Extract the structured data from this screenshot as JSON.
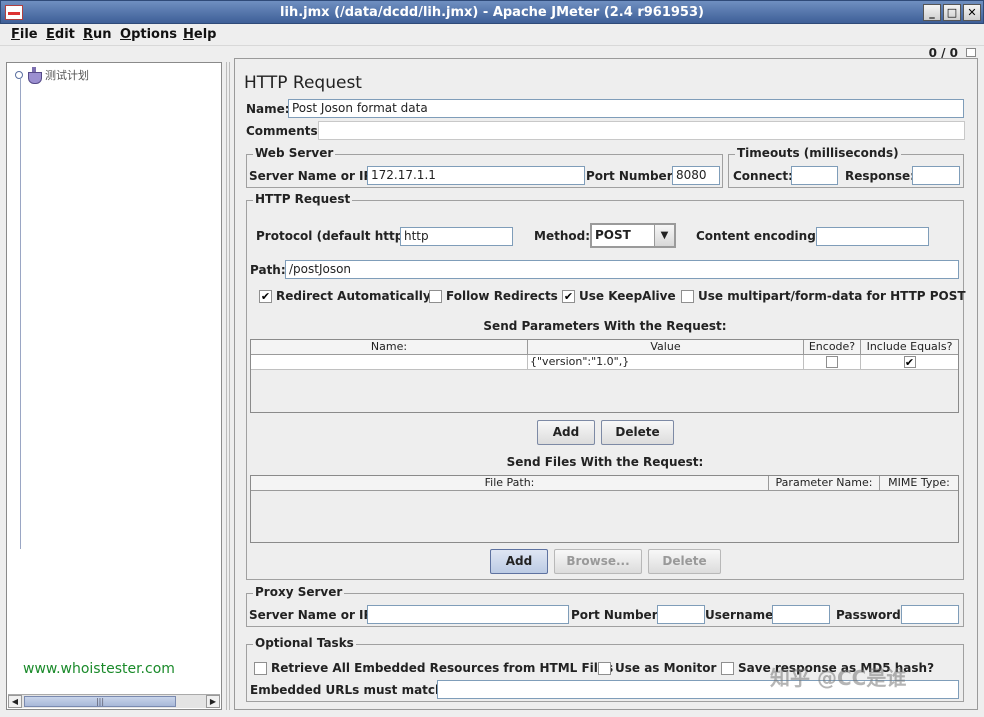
{
  "window": {
    "title": "lih.jmx (/data/dcdd/lih.jmx) - Apache JMeter (2.4 r961953)",
    "minimize_label": "_",
    "maximize_label": "□",
    "close_label": "✕"
  },
  "menubar": {
    "items": [
      {
        "mnemonic": "F",
        "rest": "ile"
      },
      {
        "mnemonic": "E",
        "rest": "dit"
      },
      {
        "mnemonic": "R",
        "rest": "un"
      },
      {
        "mnemonic": "O",
        "rest": "ptions"
      },
      {
        "mnemonic": "H",
        "rest": "elp"
      }
    ]
  },
  "status": {
    "counter": "0 / 0"
  },
  "tree": {
    "root_label": "测试计划"
  },
  "watermarks": {
    "left": "www.whoistester.com",
    "right": "知乎 @CC是谁"
  },
  "panel": {
    "title": "HTTP Request",
    "name_label": "Name:",
    "name_value": "Post Joson format data",
    "comments_label": "Comments:",
    "comments_value": ""
  },
  "web_server": {
    "legend": "Web Server",
    "server_label": "Server Name or IP:",
    "server_value": "172.17.1.1",
    "port_label": "Port Number:",
    "port_value": "8080"
  },
  "timeouts": {
    "legend": "Timeouts (milliseconds)",
    "connect_label": "Connect:",
    "connect_value": "",
    "response_label": "Response:",
    "response_value": ""
  },
  "http_request": {
    "legend": "HTTP Request",
    "protocol_label": "Protocol (default http):",
    "protocol_value": "http",
    "method_label": "Method:",
    "method_value": "POST",
    "encoding_label": "Content encoding:",
    "encoding_value": "",
    "path_label": "Path:",
    "path_value": "/postJoson",
    "options": [
      {
        "label": "Redirect Automatically",
        "checked": true
      },
      {
        "label": "Follow Redirects",
        "checked": false
      },
      {
        "label": "Use KeepAlive",
        "checked": true
      },
      {
        "label": "Use multipart/form-data for HTTP POST",
        "checked": false
      }
    ]
  },
  "parameters": {
    "heading": "Send Parameters With the Request:",
    "columns": [
      "Name:",
      "Value",
      "Encode?",
      "Include Equals?"
    ],
    "rows": [
      {
        "name": "",
        "value": "{\"version\":\"1.0\",}",
        "encode": false,
        "include_equals": true
      }
    ],
    "add_label": "Add",
    "delete_label": "Delete"
  },
  "files": {
    "heading": "Send Files With the Request:",
    "columns": [
      "File Path:",
      "Parameter Name:",
      "MIME Type:"
    ],
    "add_label": "Add",
    "browse_label": "Browse...",
    "delete_label": "Delete"
  },
  "proxy": {
    "legend": "Proxy Server",
    "server_label": "Server Name or IP:",
    "port_label": "Port Number:",
    "username_label": "Username",
    "password_label": "Password"
  },
  "optional": {
    "legend": "Optional Tasks",
    "retrieve_label": "Retrieve All Embedded Resources from HTML Files",
    "monitor_label": "Use as Monitor",
    "md5_label": "Save response as MD5 hash?",
    "embedded_label": "Embedded URLs must match:"
  },
  "glyphs": {
    "check": "✔",
    "down_arrow": "▼",
    "left_arrow": "◀",
    "right_arrow": "▶",
    "thumb_grip": "|||"
  }
}
